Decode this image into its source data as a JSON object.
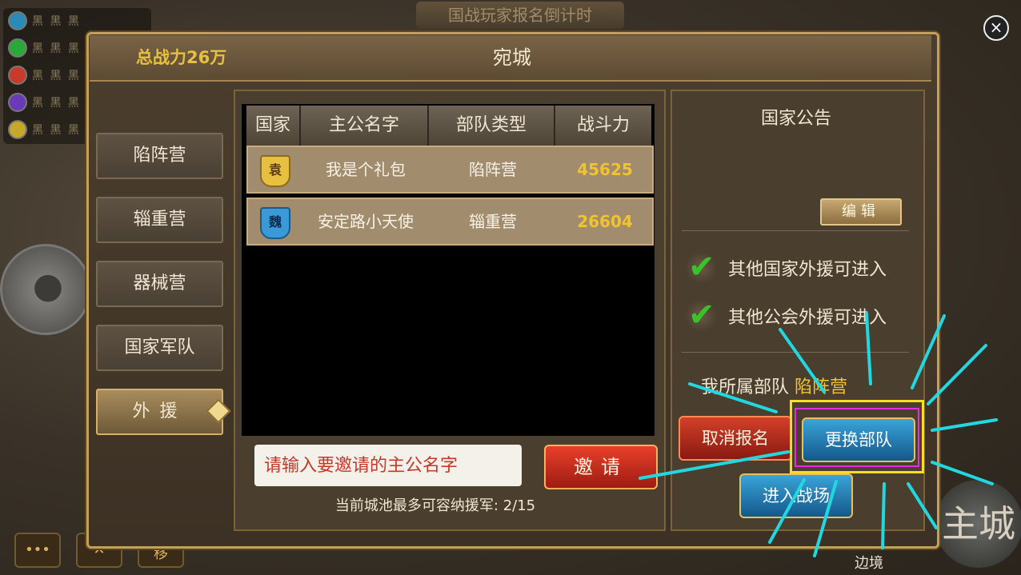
{
  "background": {
    "banner": "国战玩家报名倒计时",
    "border_label": "边境",
    "main_city_glyph": "主城"
  },
  "legend": {
    "rows": [
      {
        "color": "#2a8ab8",
        "glyph": "黑 黑 黑"
      },
      {
        "color": "#2aa83a",
        "glyph": "黑 黑 黑"
      },
      {
        "color": "#c83a2a",
        "glyph": "黑 黑 黑"
      },
      {
        "color": "#6a3ab8",
        "glyph": "黑 黑 黑"
      },
      {
        "color": "#c8a82a",
        "glyph": "黑 黑 黑"
      }
    ]
  },
  "header": {
    "total_power": "总战力26万",
    "city_name": "宛城"
  },
  "tabs": [
    {
      "label": "陷阵营",
      "active": false
    },
    {
      "label": "辎重营",
      "active": false
    },
    {
      "label": "器械营",
      "active": false
    },
    {
      "label": "国家军队",
      "active": false
    },
    {
      "label": "外援",
      "active": true
    }
  ],
  "table": {
    "headers": [
      "国家",
      "主公名字",
      "部队类型",
      "战斗力"
    ],
    "rows": [
      {
        "country": "袁",
        "country_color": "#e8c040",
        "name": "我是个礼包",
        "unit": "陷阵营",
        "power": "45625"
      },
      {
        "country": "魏",
        "country_color": "#3a9ad8",
        "name": "安定路小天使",
        "unit": "辎重营",
        "power": "26604"
      }
    ]
  },
  "invite": {
    "placeholder": "请输入要邀请的主公名字",
    "button": "邀请"
  },
  "capacity": {
    "label": "当前城池最多可容纳援军:",
    "value": "2/15"
  },
  "notice": {
    "title": "国家公告",
    "edit_button": "编辑"
  },
  "options": [
    {
      "label": "其他国家外援可进入",
      "checked": true
    },
    {
      "label": "其他公会外援可进入",
      "checked": true
    }
  ],
  "my_unit": {
    "label": "我所属部队",
    "value": "陷阵营"
  },
  "actions": {
    "cancel": "取消报名",
    "change": "更换部队",
    "enter": "进入战场"
  },
  "close_icon": "×",
  "colors": {
    "accent_gold": "#f2c330",
    "highlight_yellow": "#f8e020",
    "highlight_magenta": "#e030e0",
    "arrow_cyan": "#22d8e0"
  }
}
